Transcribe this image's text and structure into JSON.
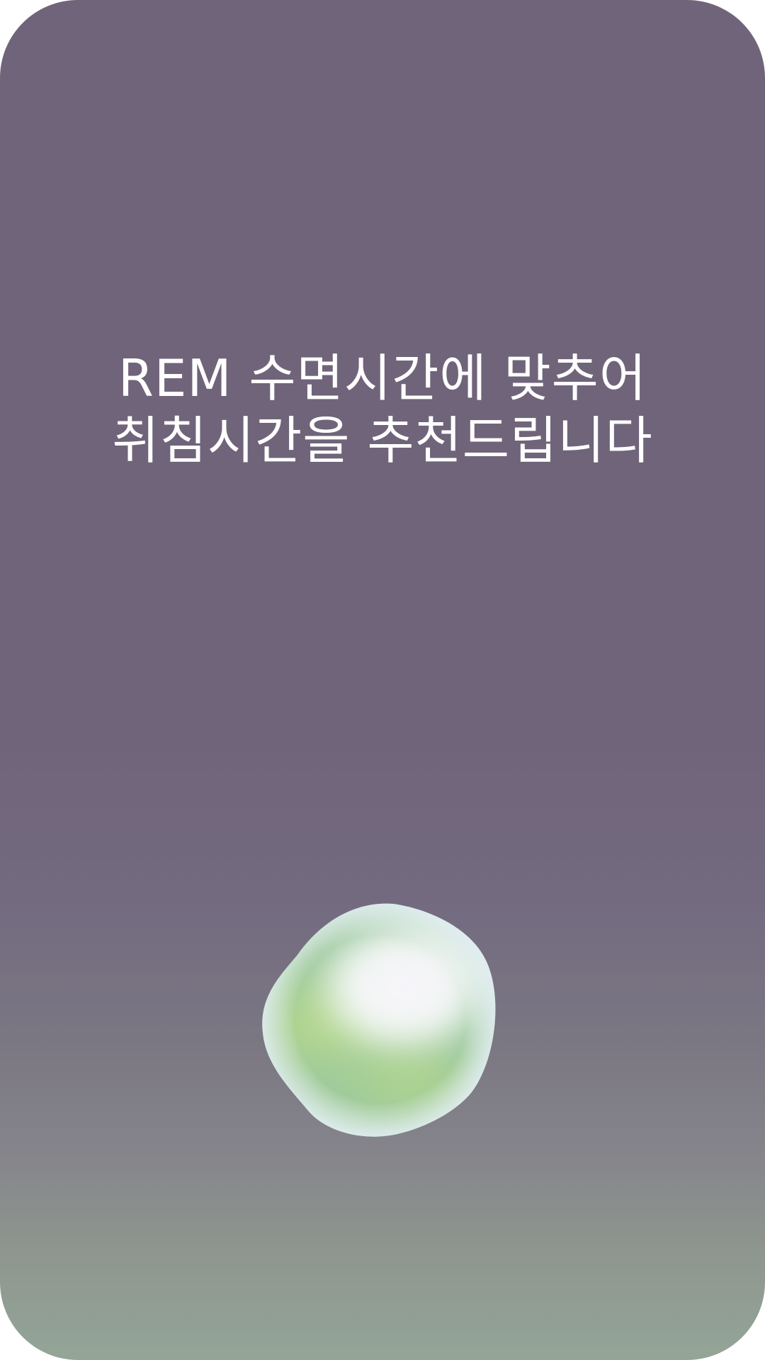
{
  "headline": {
    "line1": "REM 수면시간에 맞추어",
    "line2": "취침시간을 추천드립니다"
  },
  "orb": {
    "icon": "sleep-orb-blob",
    "colors": {
      "green": "#9cc89a",
      "lime": "#b5d68f",
      "light_blue": "#dfeaf2",
      "white": "#f8f8fb"
    }
  },
  "colors": {
    "background_top": "#70647a",
    "background_bottom": "#94a597",
    "text": "#ffffff"
  }
}
